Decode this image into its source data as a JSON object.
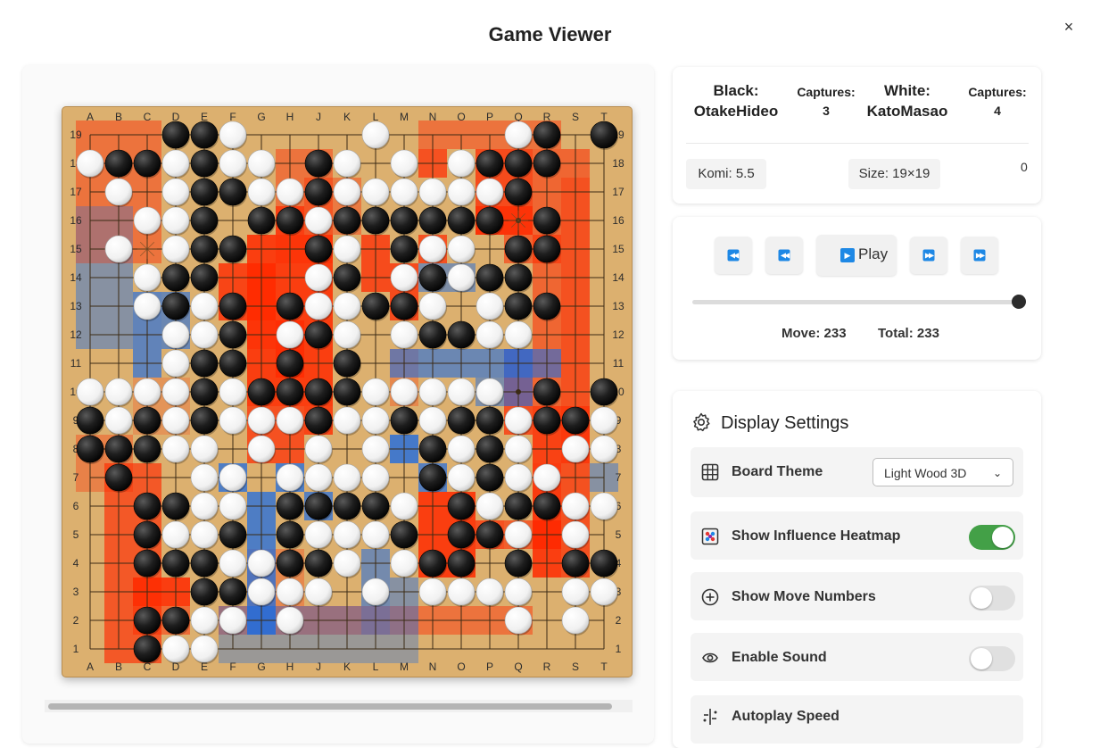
{
  "dialog": {
    "title": "Game Viewer",
    "close_label": "×"
  },
  "players": {
    "black_label": "Black:",
    "black_name": "OtakeHideo",
    "black_captures_label": "Captures:",
    "black_captures": "3",
    "white_label": "White:",
    "white_name": "KatoMasao",
    "white_captures_label": "Captures:",
    "white_captures": "4"
  },
  "game_info": {
    "komi": "Komi: 5.5",
    "size": "Size: 19×19",
    "extra_value": "0"
  },
  "playback": {
    "play_label": "Play",
    "move_text": "Move: 233",
    "total_text": "Total: 233",
    "progress": 1.0
  },
  "settings": {
    "heading": "Display Settings",
    "board_theme_label": "Board Theme",
    "board_theme_value": "Light Wood 3D",
    "heatmap_label": "Show Influence Heatmap",
    "heatmap_on": true,
    "move_numbers_label": "Show Move Numbers",
    "move_numbers_on": false,
    "sound_label": "Enable Sound",
    "sound_on": false,
    "autoplay_label": "Autoplay Speed"
  },
  "board": {
    "size": 19,
    "col_labels": [
      "A",
      "B",
      "C",
      "D",
      "E",
      "F",
      "G",
      "H",
      "J",
      "K",
      "L",
      "M",
      "N",
      "O",
      "P",
      "Q",
      "R",
      "S",
      "T"
    ],
    "row_labels": [
      "19",
      "18",
      "17",
      "16",
      "15",
      "14",
      "13",
      "12",
      "11",
      "10",
      "9",
      "8",
      "7",
      "6",
      "5",
      "4",
      "3",
      "2",
      "1"
    ],
    "stone_rows": [
      "...BBW....W....WB.B",
      "WBBWBWW.BW.W.WBBB..",
      ".W.WBBWWBWWWWWWB...",
      "..WWB.BBWBBBBBB.B..",
      ".W.WBB..BW.BWW.BB..",
      "..WBB...WB.WBWBB...",
      "..WBWB.BWWBBW.WBB..",
      "...WWB.WBW.WBBWW...",
      "...WBB.B.B.........",
      "WWWWBWBBBBWWWWW.B.B",
      "BWBWBWWWBWWBWBBWBBW",
      "BBBWW.W.W.W.BWBW.WW",
      ".B..WW.WWWW.BWBWW..",
      "..BBWW.BBBBW.BWBBWW",
      "..BWWB.BWWWB.BBW.W.",
      "..BBBWWBBW.WBB.B.BB",
      "....BBWWW.W.WWWW.WW",
      "..BBWW.W.......W.W.",
      "..BWW.............."
    ],
    "heat_red": "#ff2a00",
    "heat_blue": "#1f6ce0",
    "red_zones": [
      [
        0,
        2,
        0,
        4,
        0.45
      ],
      [
        12,
        16,
        0,
        0,
        0.45
      ],
      [
        16,
        17,
        1,
        15,
        0.55
      ],
      [
        17,
        17,
        2,
        15,
        0.35
      ],
      [
        7,
        8,
        1,
        4,
        0.45
      ],
      [
        8,
        9,
        2,
        3,
        0.4
      ],
      [
        7,
        7,
        3,
        3,
        0.7
      ],
      [
        6,
        6,
        5,
        7,
        0.5
      ],
      [
        14,
        15,
        1,
        3,
        0.75
      ],
      [
        15,
        16,
        4,
        4,
        0.55
      ],
      [
        6,
        8,
        4,
        9,
        0.85
      ],
      [
        5,
        6,
        5,
        6,
        0.8
      ],
      [
        7,
        7,
        7,
        8,
        0.75
      ],
      [
        6,
        7,
        10,
        11,
        0.7
      ],
      [
        8,
        8,
        10,
        10,
        0.8
      ],
      [
        10,
        10,
        4,
        5,
        0.75
      ],
      [
        11,
        11,
        5,
        6,
        0.75
      ],
      [
        12,
        12,
        1,
        1,
        0.7
      ],
      [
        12,
        12,
        4,
        4,
        0.7
      ],
      [
        14,
        15,
        3,
        3,
        0.7
      ],
      [
        15,
        15,
        8,
        10,
        0.7
      ],
      [
        16,
        16,
        12,
        14,
        0.7
      ],
      [
        15,
        16,
        14,
        14,
        0.6
      ],
      [
        16,
        17,
        10,
        11,
        0.6
      ],
      [
        1,
        2,
        12,
        18,
        0.65
      ],
      [
        2,
        3,
        16,
        17,
        0.5
      ],
      [
        0,
        1,
        11,
        12,
        0.35
      ],
      [
        12,
        13,
        13,
        15,
        0.85
      ],
      [
        14,
        14,
        14,
        14,
        0.7
      ],
      [
        16,
        16,
        14,
        15,
        0.65
      ],
      [
        2,
        3,
        16,
        16,
        0.7
      ],
      [
        5,
        15,
        17,
        17,
        0.45
      ],
      [
        6,
        7,
        15,
        16,
        0.3
      ],
      [
        11,
        11,
        8,
        9,
        0.3
      ],
      [
        2,
        3,
        9,
        10,
        0.2
      ]
    ],
    "blue_zones": [
      [
        0,
        1,
        3,
        4,
        0.3
      ],
      [
        0,
        1,
        5,
        7,
        0.45
      ],
      [
        2,
        2,
        6,
        8,
        0.65
      ],
      [
        3,
        3,
        6,
        7,
        0.6
      ],
      [
        11,
        16,
        8,
        8,
        0.6
      ],
      [
        12,
        13,
        5,
        5,
        0.5
      ],
      [
        15,
        15,
        8,
        9,
        0.6
      ],
      [
        14,
        14,
        9,
        9,
        0.5
      ],
      [
        11,
        11,
        11,
        11,
        0.8
      ],
      [
        12,
        12,
        12,
        12,
        0.7
      ],
      [
        5,
        5,
        12,
        12,
        0.75
      ],
      [
        7,
        7,
        12,
        12,
        0.75
      ],
      [
        8,
        8,
        13,
        13,
        0.7
      ],
      [
        6,
        6,
        13,
        17,
        0.75
      ],
      [
        10,
        10,
        15,
        17,
        0.55
      ],
      [
        11,
        11,
        16,
        17,
        0.45
      ],
      [
        5,
        9,
        17,
        17,
        0.4
      ],
      [
        5,
        11,
        18,
        18,
        0.35
      ],
      [
        6,
        6,
        17,
        17,
        0.35
      ],
      [
        18,
        18,
        12,
        12,
        0.45
      ]
    ],
    "star_marks": [
      [
        2,
        4
      ],
      [
        8,
        9
      ],
      [
        15,
        13
      ],
      [
        15,
        16
      ],
      [
        15,
        3
      ],
      [
        8,
        5
      ]
    ]
  }
}
